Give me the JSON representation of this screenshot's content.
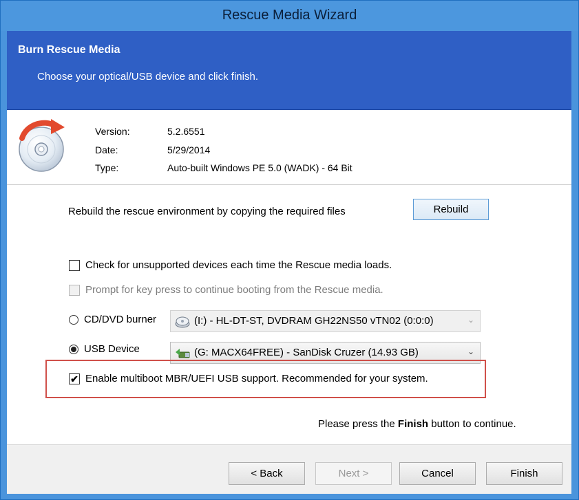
{
  "window": {
    "title": "Rescue Media Wizard"
  },
  "banner": {
    "title": "Burn Rescue Media",
    "subtitle": "Choose your optical/USB device and click finish."
  },
  "info": {
    "version_label": "Version:",
    "version_value": "5.2.6551",
    "date_label": "Date:",
    "date_value": "5/29/2014",
    "type_label": "Type:",
    "type_value": "Auto-built Windows PE 5.0 (WADK) - 64 Bit"
  },
  "rebuild": {
    "text": "Rebuild the rescue environment by copying the required files",
    "button": "Rebuild"
  },
  "options": {
    "check_unsupported": {
      "label": "Check for unsupported devices each time the Rescue media loads.",
      "checked": false
    },
    "prompt_keypress": {
      "label": "Prompt for key press to continue booting from the Rescue media.",
      "checked": false,
      "disabled": true
    },
    "multiboot": {
      "label": "Enable multiboot MBR/UEFI USB support. Recommended for your system.",
      "checked": true,
      "check_glyph": "✔"
    }
  },
  "devices": {
    "cd": {
      "label": "CD/DVD burner",
      "selected": false,
      "combo_value": "(I:) - HL-DT-ST, DVDRAM GH22NS50  vTN02 (0:0:0)",
      "icon": "optical-drive-icon"
    },
    "usb": {
      "label": "USB Device",
      "selected": true,
      "combo_value": "(G: MACX64FREE) - SanDisk Cruzer (14.93 GB)",
      "icon": "usb-drive-icon"
    },
    "arrow_glyph": "⌄"
  },
  "finish_note": {
    "prefix": "Please press the",
    "bold": "Finish",
    "suffix": "button to continue."
  },
  "footer": {
    "back": "< Back",
    "next": "Next >",
    "cancel": "Cancel",
    "finish": "Finish"
  },
  "colors": {
    "banner": "#2f5fc5",
    "titlebar": "#4c97de",
    "highlight": "#d0504a"
  }
}
